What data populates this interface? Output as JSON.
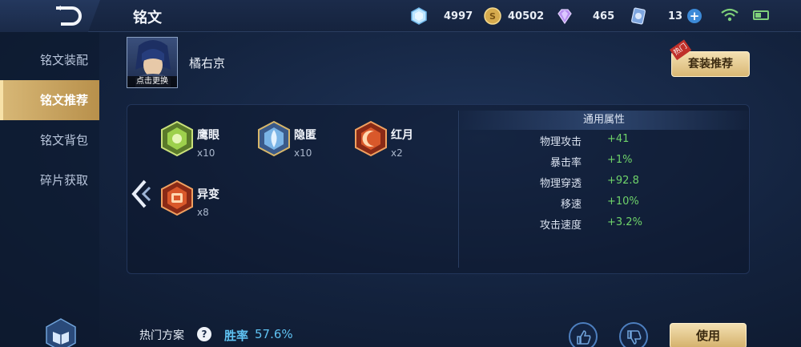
{
  "header": {
    "title": "铭文",
    "back_icon": "back-arrow-icon",
    "currencies": [
      {
        "icon": "diamond-gem-icon",
        "value": "4997"
      },
      {
        "icon": "gold-coin-icon",
        "value": "40502"
      },
      {
        "icon": "purple-crystal-icon",
        "value": "465"
      },
      {
        "icon": "card-ticket-icon",
        "value": "13"
      }
    ],
    "plus_label": "+"
  },
  "sidebar": {
    "items": [
      {
        "label": "铭文装配",
        "active": false
      },
      {
        "label": "铭文推荐",
        "active": true
      },
      {
        "label": "铭文背包",
        "active": false
      },
      {
        "label": "碎片获取",
        "active": false
      }
    ]
  },
  "hero": {
    "name": "橘右京",
    "change_label": "点击更换"
  },
  "recommend_button": {
    "label": "套装推荐",
    "tag": "热门"
  },
  "runes": [
    {
      "name": "鹰眼",
      "count": "x10",
      "color": "#79b33a"
    },
    {
      "name": "隐匿",
      "count": "x10",
      "color": "#6b9bd6"
    },
    {
      "name": "红月",
      "count": "x2",
      "color": "#d0552a"
    },
    {
      "name": "异变",
      "count": "x8",
      "color": "#d0552a"
    }
  ],
  "attributes": {
    "header": "通用属性",
    "rows": [
      {
        "key": "物理攻击",
        "value": "+41"
      },
      {
        "key": "暴击率",
        "value": "+1%"
      },
      {
        "key": "物理穿透",
        "value": "+92.8"
      },
      {
        "key": "移速",
        "value": "+10%"
      },
      {
        "key": "攻击速度",
        "value": "+3.2%"
      }
    ]
  },
  "bottom": {
    "hot_plan_label": "热门方案",
    "help_label": "?",
    "winrate_label": "胜率",
    "winrate_value": "57.6%",
    "use_label": "使用"
  },
  "colors": {
    "accent_gold": "#d9b874",
    "positive_green": "#6fd36a",
    "winrate_blue": "#5fc2f2"
  }
}
